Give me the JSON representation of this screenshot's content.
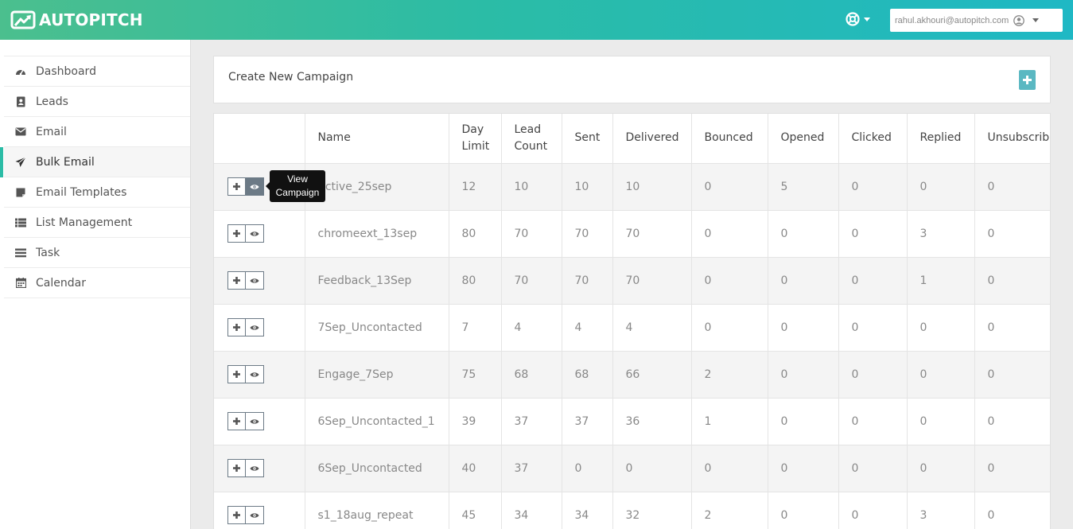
{
  "header": {
    "brand": "AUTOPITCH",
    "user_email": "rahul.akhouri@autopitch.com"
  },
  "sidebar": {
    "items": [
      {
        "label": "Dashboard",
        "icon": "dashboard-icon"
      },
      {
        "label": "Leads",
        "icon": "contact-book-icon"
      },
      {
        "label": "Email",
        "icon": "envelope-icon"
      },
      {
        "label": "Bulk Email",
        "icon": "paper-plane-icon",
        "active": true
      },
      {
        "label": "Email Templates",
        "icon": "sticky-note-icon"
      },
      {
        "label": "List Management",
        "icon": "list-icon"
      },
      {
        "label": "Task",
        "icon": "tasks-icon"
      },
      {
        "label": "Calendar",
        "icon": "calendar-icon"
      }
    ]
  },
  "create_panel": {
    "title": "Create New Campaign"
  },
  "tooltip": {
    "line1": "View",
    "line2": "Campaign"
  },
  "table": {
    "columns": [
      {
        "line1": "",
        "line2": ""
      },
      {
        "line1": "Name",
        "line2": ""
      },
      {
        "line1": "Day",
        "line2": "Limit"
      },
      {
        "line1": "Lead",
        "line2": "Count"
      },
      {
        "line1": "Sent",
        "line2": ""
      },
      {
        "line1": "Delivered",
        "line2": ""
      },
      {
        "line1": "Bounced",
        "line2": ""
      },
      {
        "line1": "Opened",
        "line2": ""
      },
      {
        "line1": "Clicked",
        "line2": ""
      },
      {
        "line1": "Replied",
        "line2": ""
      },
      {
        "line1": "Unsubscribed",
        "line2": ""
      }
    ],
    "rows": [
      [
        "Active_25sep",
        "12",
        "10",
        "10",
        "10",
        "0",
        "5",
        "0",
        "0",
        "0"
      ],
      [
        "chromeext_13sep",
        "80",
        "70",
        "70",
        "70",
        "0",
        "0",
        "0",
        "3",
        "0"
      ],
      [
        "Feedback_13Sep",
        "80",
        "70",
        "70",
        "70",
        "0",
        "0",
        "0",
        "1",
        "0"
      ],
      [
        "7Sep_Uncontacted",
        "7",
        "4",
        "4",
        "4",
        "0",
        "0",
        "0",
        "0",
        "0"
      ],
      [
        "Engage_7Sep",
        "75",
        "68",
        "68",
        "66",
        "2",
        "0",
        "0",
        "0",
        "0"
      ],
      [
        "6Sep_Uncontacted_1",
        "39",
        "37",
        "37",
        "36",
        "1",
        "0",
        "0",
        "0",
        "0"
      ],
      [
        "6Sep_Uncontacted",
        "40",
        "37",
        "0",
        "0",
        "0",
        "0",
        "0",
        "0",
        "0"
      ],
      [
        "s1_18aug_repeat",
        "45",
        "34",
        "34",
        "32",
        "2",
        "0",
        "0",
        "3",
        "0"
      ]
    ]
  },
  "colors": {
    "header_start": "#4bbf8e",
    "header_end": "#1fb8c4",
    "accent": "#2bbca6",
    "add_button": "#5bb8c2",
    "action_button": "#6c7a86"
  }
}
